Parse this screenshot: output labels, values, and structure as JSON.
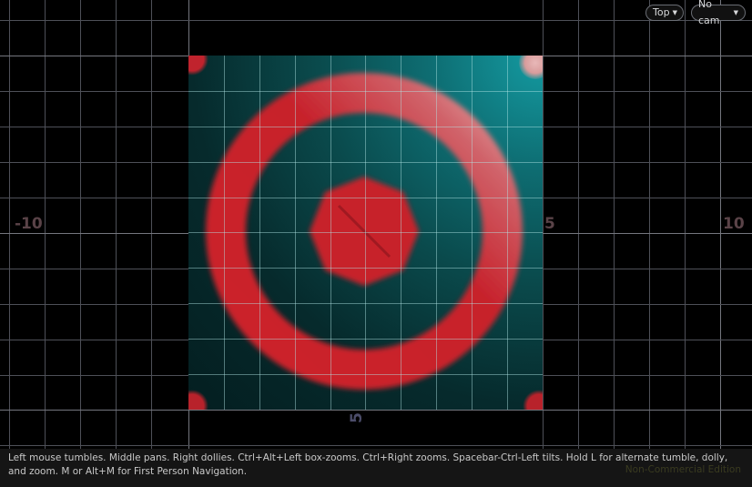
{
  "viewport": {
    "view_menu": {
      "label": "Top",
      "icon": "chevron-down-icon"
    },
    "camera_menu": {
      "label": "No cam",
      "icon": "chevron-down-icon"
    },
    "axis_labels": {
      "x_neg": "-10",
      "x_pos5": "5",
      "x_pos10": "10",
      "y_5": "5"
    }
  },
  "footer": {
    "help_text": "Left mouse tumbles. Middle pans. Right dollies. Ctrl+Alt+Left box-zooms. Ctrl+Right zooms. Spacebar-Ctrl-Left tilts. Hold L for alternate tumble, dolly, and zoom.    M or Alt+M for First Person Navigation.",
    "edition": "Non-Commercial Edition"
  },
  "colors": {
    "ring": "#c7222c",
    "teal_glow": "#149ba2",
    "background": "#000000",
    "grid": "#4e5058"
  }
}
